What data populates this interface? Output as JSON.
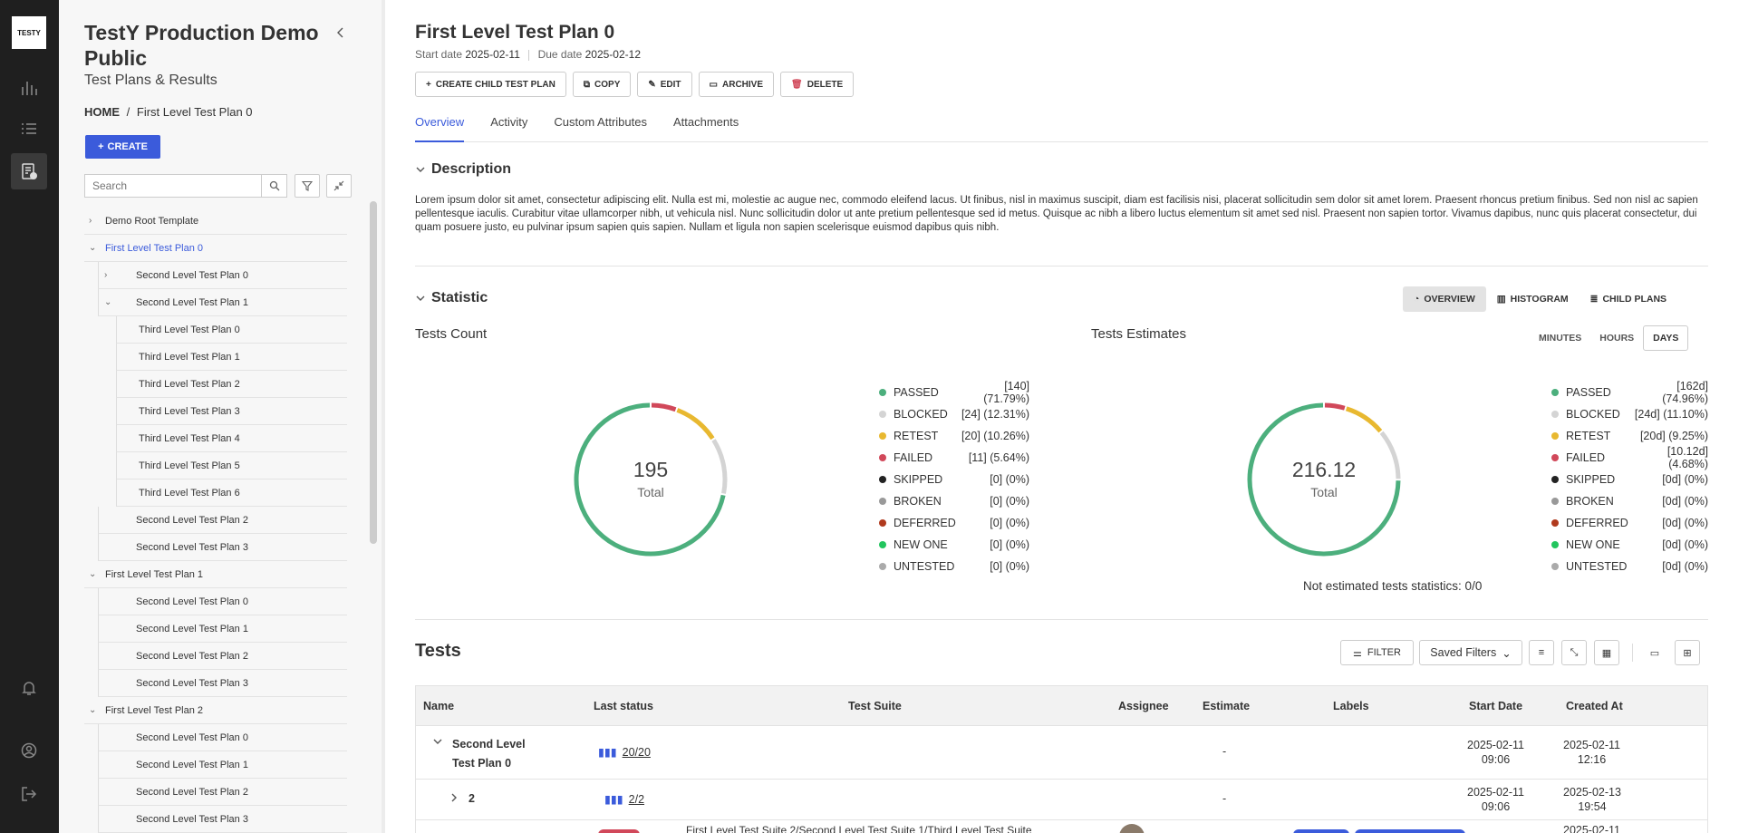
{
  "rail": {
    "logo": "TESTY"
  },
  "sidebar": {
    "project_title": "TestY Production Demo Public",
    "subtitle": "Test Plans & Results",
    "breadcrumb_home": "HOME",
    "breadcrumb_sep": "/",
    "breadcrumb_current": "First Level Test Plan 0",
    "create_label": "CREATE",
    "search_placeholder": "Search",
    "tree": [
      {
        "label": "Demo Root Template",
        "level": 0,
        "chev": "›"
      },
      {
        "label": "First Level Test Plan 0",
        "level": 0,
        "chev": "⌄",
        "selected": true
      },
      {
        "label": "Second Level Test Plan 0",
        "level": 1,
        "chev": "›"
      },
      {
        "label": "Second Level Test Plan 1",
        "level": 1,
        "chev": "⌄"
      },
      {
        "label": "Third Level Test Plan 0",
        "level": 2
      },
      {
        "label": "Third Level Test Plan 1",
        "level": 2
      },
      {
        "label": "Third Level Test Plan 2",
        "level": 2
      },
      {
        "label": "Third Level Test Plan 3",
        "level": 2
      },
      {
        "label": "Third Level Test Plan 4",
        "level": 2
      },
      {
        "label": "Third Level Test Plan 5",
        "level": 2
      },
      {
        "label": "Third Level Test Plan 6",
        "level": 2
      },
      {
        "label": "Second Level Test Plan 2",
        "level": 1
      },
      {
        "label": "Second Level Test Plan 3",
        "level": 1
      },
      {
        "label": "First Level Test Plan 1",
        "level": 0,
        "chev": "⌄"
      },
      {
        "label": "Second Level Test Plan 0",
        "level": 1
      },
      {
        "label": "Second Level Test Plan 1",
        "level": 1
      },
      {
        "label": "Second Level Test Plan 2",
        "level": 1
      },
      {
        "label": "Second Level Test Plan 3",
        "level": 1
      },
      {
        "label": "First Level Test Plan 2",
        "level": 0,
        "chev": "⌄"
      },
      {
        "label": "Second Level Test Plan 0",
        "level": 1
      },
      {
        "label": "Second Level Test Plan 1",
        "level": 1
      },
      {
        "label": "Second Level Test Plan 2",
        "level": 1
      },
      {
        "label": "Second Level Test Plan 3",
        "level": 1
      }
    ]
  },
  "main": {
    "title": "First Level Test Plan 0",
    "start_label": "Start date",
    "start_value": "2025-02-11",
    "due_label": "Due date",
    "due_value": "2025-02-12",
    "actions": {
      "create_child": "CREATE CHILD TEST PLAN",
      "copy": "COPY",
      "edit": "EDIT",
      "archive": "ARCHIVE",
      "delete": "DELETE"
    },
    "tabs": [
      "Overview",
      "Activity",
      "Custom Attributes",
      "Attachments"
    ],
    "description_heading": "Description",
    "description_text": "Lorem ipsum dolor sit amet, consectetur adipiscing elit. Nulla est mi, molestie ac augue nec, commodo eleifend lacus. Ut finibus, nisl in maximus suscipit, diam est facilisis nisi, placerat sollicitudin sem dolor sit amet lorem. Praesent rhoncus pretium finibus. Sed non nisl ac sapien pellentesque iaculis. Curabitur vitae ullamcorper nibh, ut vehicula nisl. Nunc sollicitudin dolor ut ante pretium pellentesque sed id metus. Quisque ac nibh a libero luctus elementum sit amet sed nisl. Praesent non sapien tortor. Vivamus dapibus, nunc quis placerat consectetur, dui quam posuere justo, eu pulvinar ipsum sapien quis sapien. Nullam et ligula non sapien scelerisque euismod dapibus quis nibh.",
    "statistic_heading": "Statistic",
    "stat_views": [
      "OVERVIEW",
      "HISTOGRAM",
      "CHILD PLANS"
    ],
    "tests_count_heading": "Tests Count",
    "tests_estimates_heading": "Tests Estimates",
    "units": [
      "MINUTES",
      "HOURS",
      "DAYS"
    ],
    "total_label": "Total",
    "not_estimated": "Not estimated tests statistics: 0/0",
    "tests_heading": "Tests",
    "filter_label": "FILTER",
    "saved_filters_label": "Saved Filters",
    "table_headers": [
      "Name",
      "Last status",
      "Test Suite",
      "Assignee",
      "Estimate",
      "Labels",
      "Start Date",
      "Created At"
    ],
    "rows": [
      {
        "name_line1": "Second Level",
        "name_line2": "Test Plan 0",
        "status": "20/20",
        "estimate": "-",
        "start_line1": "2025-02-11",
        "start_line2": "09:06",
        "created_line1": "2025-02-11",
        "created_line2": "12:16"
      },
      {
        "name_line1": "2",
        "status": "2/2",
        "estimate": "-",
        "start_line1": "2025-02-11",
        "start_line2": "09:06",
        "created_line1": "2025-02-13",
        "created_line2": "19:54"
      }
    ],
    "partial_row": {
      "suite": "First Level Test Suite 2/Second Level Test Suite 1/Third Level Test Suite",
      "created_line1": "2025-02-11"
    }
  },
  "chart_data": [
    {
      "type": "pie",
      "title": "Tests Count",
      "total": "195",
      "series": [
        {
          "name": "PASSED",
          "value": 140,
          "text": "[140] (71.79%)",
          "color": "#4caf7d"
        },
        {
          "name": "BLOCKED",
          "value": 24,
          "text": "[24] (12.31%)",
          "color": "#d4d4d4"
        },
        {
          "name": "RETEST",
          "value": 20,
          "text": "[20] (10.26%)",
          "color": "#e8b830"
        },
        {
          "name": "FAILED",
          "value": 11,
          "text": "[11] (5.64%)",
          "color": "#d1485a"
        },
        {
          "name": "SKIPPED",
          "value": 0,
          "text": "[0] (0%)",
          "color": "#222222"
        },
        {
          "name": "BROKEN",
          "value": 0,
          "text": "[0] (0%)",
          "color": "#999999"
        },
        {
          "name": "DEFERRED",
          "value": 0,
          "text": "[0] (0%)",
          "color": "#b03a1e"
        },
        {
          "name": "NEW ONE",
          "value": 0,
          "text": "[0] (0%)",
          "color": "#22c55e"
        },
        {
          "name": "UNTESTED",
          "value": 0,
          "text": "[0] (0%)",
          "color": "#aaaaaa"
        }
      ]
    },
    {
      "type": "pie",
      "title": "Tests Estimates",
      "total": "216.12",
      "series": [
        {
          "name": "PASSED",
          "value": 162,
          "text": "[162d] (74.96%)",
          "color": "#4caf7d"
        },
        {
          "name": "BLOCKED",
          "value": 24,
          "text": "[24d] (11.10%)",
          "color": "#d4d4d4"
        },
        {
          "name": "RETEST",
          "value": 20,
          "text": "[20d] (9.25%)",
          "color": "#e8b830"
        },
        {
          "name": "FAILED",
          "value": 10.12,
          "text": "[10.12d] (4.68%)",
          "color": "#d1485a"
        },
        {
          "name": "SKIPPED",
          "value": 0,
          "text": "[0d] (0%)",
          "color": "#222222"
        },
        {
          "name": "BROKEN",
          "value": 0,
          "text": "[0d] (0%)",
          "color": "#999999"
        },
        {
          "name": "DEFERRED",
          "value": 0,
          "text": "[0d] (0%)",
          "color": "#b03a1e"
        },
        {
          "name": "NEW ONE",
          "value": 0,
          "text": "[0d] (0%)",
          "color": "#22c55e"
        },
        {
          "name": "UNTESTED",
          "value": 0,
          "text": "[0d] (0%)",
          "color": "#aaaaaa"
        }
      ]
    }
  ]
}
